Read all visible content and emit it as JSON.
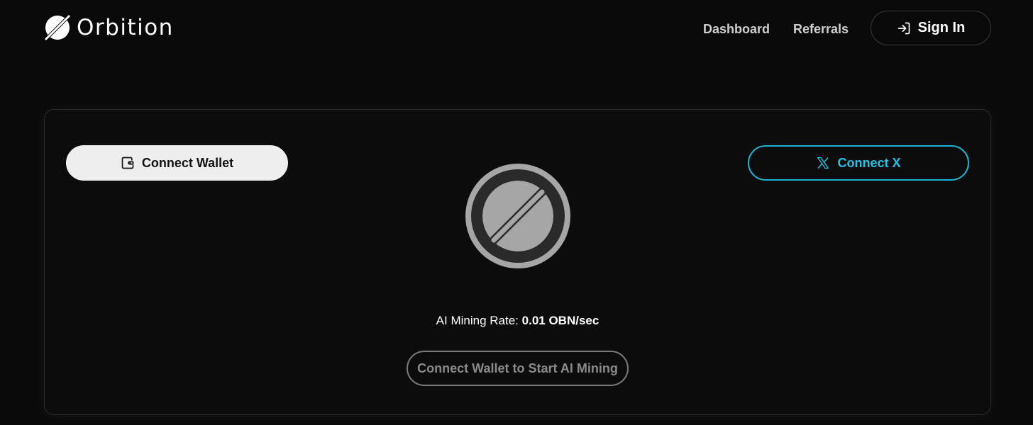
{
  "header": {
    "logo_text": "Orbition",
    "nav": {
      "dashboard": "Dashboard",
      "referrals": "Referrals"
    },
    "signin": {
      "label": "Sign In",
      "icon": "sign-in-icon"
    }
  },
  "main": {
    "connect_wallet": {
      "label": "Connect Wallet",
      "icon": "wallet-icon"
    },
    "connect_x": {
      "label": "Connect X",
      "icon": "x-logo-icon"
    },
    "orb_icon": "orbition-orb-icon",
    "mining_rate": {
      "label": "AI Mining Rate:",
      "value": "0.01 OBN/sec"
    },
    "start_mining": {
      "label": "Connect Wallet to Start AI Mining"
    }
  },
  "colors": {
    "background": "#0a0a0a",
    "accent_cyan": "#22c3e6",
    "wallet_button_bg": "#eeeeee",
    "orb_grey": "#a6a6a6"
  }
}
